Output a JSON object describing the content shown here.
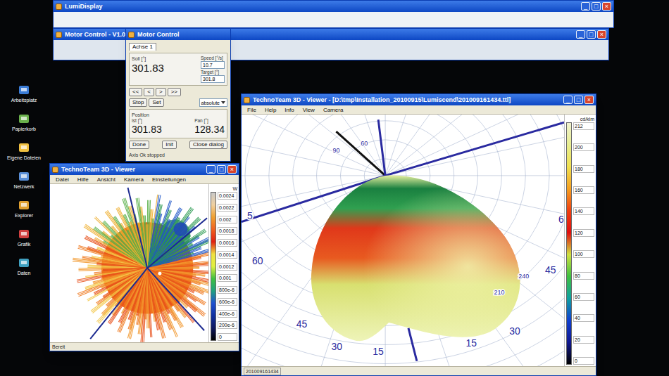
{
  "desktop_icons": [
    {
      "label": "Arbeitsplatz"
    },
    {
      "label": "Papierkorb"
    },
    {
      "label": "Eigene Dateien"
    },
    {
      "label": "Netzwerk"
    },
    {
      "label": "Explorer"
    },
    {
      "label": "Grafik"
    },
    {
      "label": "Daten"
    }
  ],
  "back_window": {
    "title": "LumiDisplay",
    "controls": [
      "_",
      "□",
      "×"
    ]
  },
  "control_window": {
    "title": "Motor Control - V1.0",
    "controls": [
      "_",
      "□",
      "×"
    ]
  },
  "motor_dialog": {
    "title": "Motor Control",
    "tab": "Achse 1",
    "setpoint": {
      "label": "Soll [°]",
      "value": "301.83"
    },
    "speed": {
      "label": "Speed [°/s]",
      "value": "10.7"
    },
    "target": {
      "label": "Target [°]",
      "value": "301.8"
    },
    "step_buttons": [
      "<<",
      "<",
      ">",
      ">>"
    ],
    "action_buttons": [
      "Stop",
      "Set"
    ],
    "mode": "absolute",
    "position": {
      "label": "Position",
      "fields": [
        {
          "label": "Ist [°]",
          "value": "301.83"
        },
        {
          "label": "Pan [°]",
          "value": "128.34"
        }
      ]
    },
    "footer_buttons": [
      "Done",
      "Init",
      "Close dialog"
    ],
    "status": "Axis Ok stopped"
  },
  "left_viewer": {
    "title": "TechnoTeam 3D - Viewer",
    "controls": [
      "_",
      "□",
      "×"
    ],
    "menu": [
      "Datei",
      "Hilfe",
      "Ansicht",
      "Kamera",
      "Einstellungen"
    ],
    "colorbar": {
      "unit": "W",
      "ticks": [
        {
          "label": "0.0024",
          "color": "#c8c8c8"
        },
        {
          "label": "0.0022",
          "color": "#f0d0a0"
        },
        {
          "label": "0.002",
          "color": "#f0a030"
        },
        {
          "label": "0.0018",
          "color": "#f06020"
        },
        {
          "label": "0.0016",
          "color": "#e02010"
        },
        {
          "label": "0.0014",
          "color": "#f0e040"
        },
        {
          "label": "0.0012",
          "color": "#e0f040"
        },
        {
          "label": "0.001",
          "color": "#40c040"
        },
        {
          "label": "800e-6",
          "color": "#20a080"
        },
        {
          "label": "600e-6",
          "color": "#2050d0"
        },
        {
          "label": "400e-6",
          "color": "#1030a0"
        },
        {
          "label": "200e-6",
          "color": "#101860"
        },
        {
          "label": "0",
          "color": "#000000"
        }
      ]
    },
    "status": "Bereit"
  },
  "right_viewer": {
    "title": "TechnoTeam 3D - Viewer - [D:\\tmp\\Installation_20100915\\Lumiscend\\201009161434.ttl]",
    "controls": [
      "_",
      "□",
      "×"
    ],
    "menu": [
      "File",
      "Help",
      "Info",
      "View",
      "Camera"
    ],
    "colorbar": {
      "unit": "cd/klm",
      "ticks": [
        {
          "label": "212",
          "color": "#f0f2d0"
        },
        {
          "label": "200",
          "color": "#e8ee90"
        },
        {
          "label": "180",
          "color": "#f0e050"
        },
        {
          "label": "160",
          "color": "#f5a020"
        },
        {
          "label": "140",
          "color": "#f04010"
        },
        {
          "label": "120",
          "color": "#e01010"
        },
        {
          "label": "100",
          "color": "#d0e040"
        },
        {
          "label": "80",
          "color": "#40c040"
        },
        {
          "label": "60",
          "color": "#10a0a0"
        },
        {
          "label": "40",
          "color": "#1040d0"
        },
        {
          "label": "20",
          "color": "#101890"
        },
        {
          "label": "0",
          "color": "#000000"
        }
      ]
    },
    "polar_labels": [
      {
        "text": "5"
      },
      {
        "text": "60"
      },
      {
        "text": "45"
      },
      {
        "text": "30"
      },
      {
        "text": "15"
      },
      {
        "text": "15"
      },
      {
        "text": "30"
      },
      {
        "text": "45"
      },
      {
        "text": "6"
      },
      {
        "text": "90"
      },
      {
        "text": "60"
      },
      {
        "text": "210"
      },
      {
        "text": "240"
      }
    ],
    "status": "201009161434"
  }
}
